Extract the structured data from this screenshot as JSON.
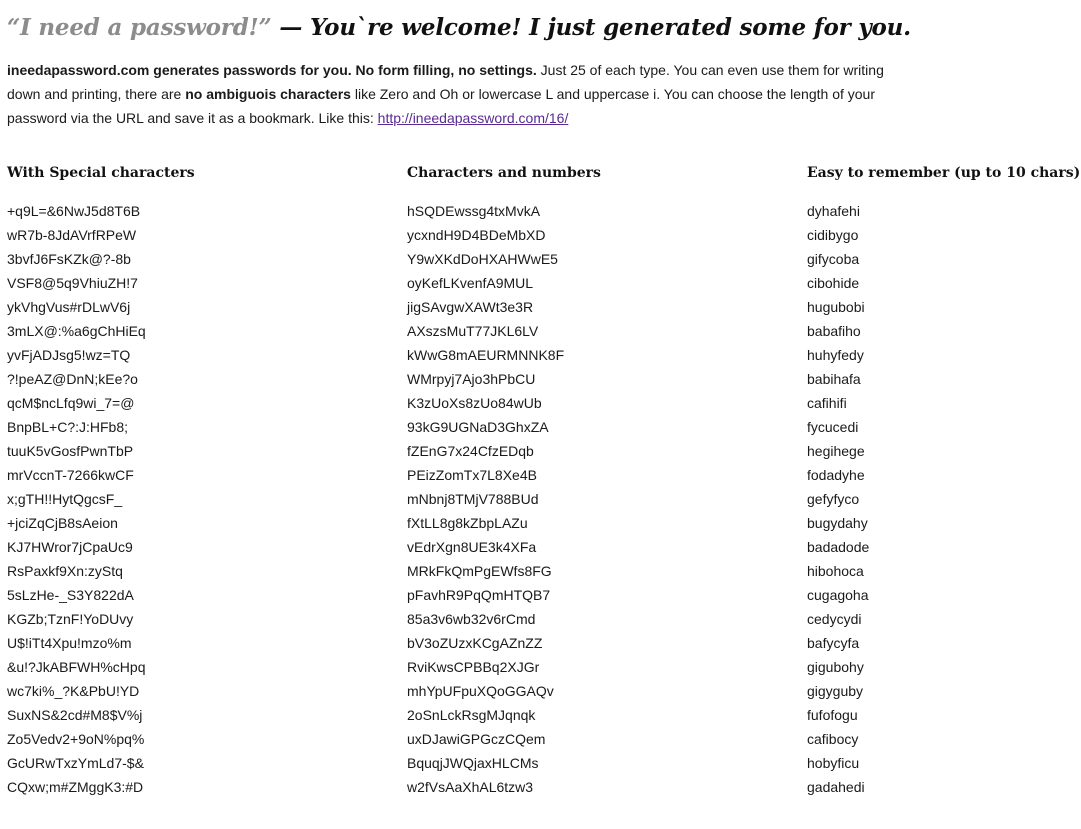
{
  "header": {
    "quote": "“I need a password!”",
    "rest": " — You`re welcome! I just generated some for you."
  },
  "intro": {
    "bold1": "ineedapassword.com generates passwords for you. No form filling, no settings.",
    "text1": " Just 25 of each type. You can even use them for writing down and printing, there are ",
    "bold2": "no ambiguois characters",
    "text2": " like Zero and Oh or lowercase L and uppercase i. You can choose the length of your password via the URL and save it as a bookmark. Like this: ",
    "link": "http://ineedapassword.com/16/",
    "link_color": "#5a2a92"
  },
  "columns": [
    {
      "heading": "With Special characters",
      "passwords": [
        "+q9L=&6NwJ5d8T6B",
        "wR7b-8JdAVrfRPeW",
        "3bvfJ6FsKZk@?-8b",
        "VSF8@5q9VhiuZH!7",
        "ykVhgVus#rDLwV6j",
        "3mLX@:%a6gChHiEq",
        "yvFjADJsg5!wz=TQ",
        "?!peAZ@DnN;kEe?o",
        "qcM$ncLfq9wi_7=@",
        "BnpBL+C?:J:HFb8;",
        "tuuK5vGosfPwnTbP",
        "mrVccnT-7266kwCF",
        "x;gTH!!HytQgcsF_",
        "+jciZqCjB8sAeion",
        "KJ7HWror7jCpaUc9",
        "RsPaxkf9Xn:zyStq",
        "5sLzHe-_S3Y822dA",
        "KGZb;TznF!YoDUvy",
        "U$!iTt4Xpu!mzo%m",
        "&u!?JkABFWH%cHpq",
        "wc7ki%_?K&PbU!YD",
        "SuxNS&2cd#M8$V%j",
        "Zo5Vedv2+9oN%pq%",
        "GcURwTxzYmLd7-$&",
        "CQxw;m#ZMggK3:#D"
      ]
    },
    {
      "heading": "Characters and numbers",
      "passwords": [
        "hSQDEwssg4txMvkA",
        "ycxndH9D4BDeMbXD",
        "Y9wXKdDoHXAHWwE5",
        "oyKefLKvenfA9MUL",
        "jigSAvgwXAWt3e3R",
        "AXszsMuT77JKL6LV",
        "kWwG8mAEURMNNK8F",
        "WMrpyj7Ajo3hPbCU",
        "K3zUoXs8zUo84wUb",
        "93kG9UGNaD3GhxZA",
        "fZEnG7x24CfzEDqb",
        "PEizZomTx7L8Xe4B",
        "mNbnj8TMjV788BUd",
        "fXtLL8g8kZbpLAZu",
        "vEdrXgn8UE3k4XFa",
        "MRkFkQmPgEWfs8FG",
        "pFavhR9PqQmHTQB7",
        "85a3v6wb32v6rCmd",
        "bV3oZUzxKCgAZnZZ",
        "RviKwsCPBBq2XJGr",
        "mhYpUFpuXQoGGAQv",
        "2oSnLckRsgMJqnqk",
        "uxDJawiGPGczCQem",
        "BquqjJWQjaxHLCMs",
        "w2fVsAaXhAL6tzw3"
      ]
    },
    {
      "heading": "Easy to remember (up to 10 chars)",
      "passwords": [
        "dyhafehi",
        "cidibygo",
        "gifycoba",
        "cibohide",
        "hugubobi",
        "babafiho",
        "huhyfedy",
        "babihafa",
        "cafihifi",
        "fycucedi",
        "hegihege",
        "fodadyhe",
        "gefyfyco",
        "bugydahy",
        "badadode",
        "hibohoca",
        "cugagoha",
        "cedycydi",
        "bafycyfa",
        "gigubohy",
        "gigyguby",
        "fufofogu",
        "cafibocy",
        "hobyficu",
        "gadahedi"
      ]
    }
  ]
}
